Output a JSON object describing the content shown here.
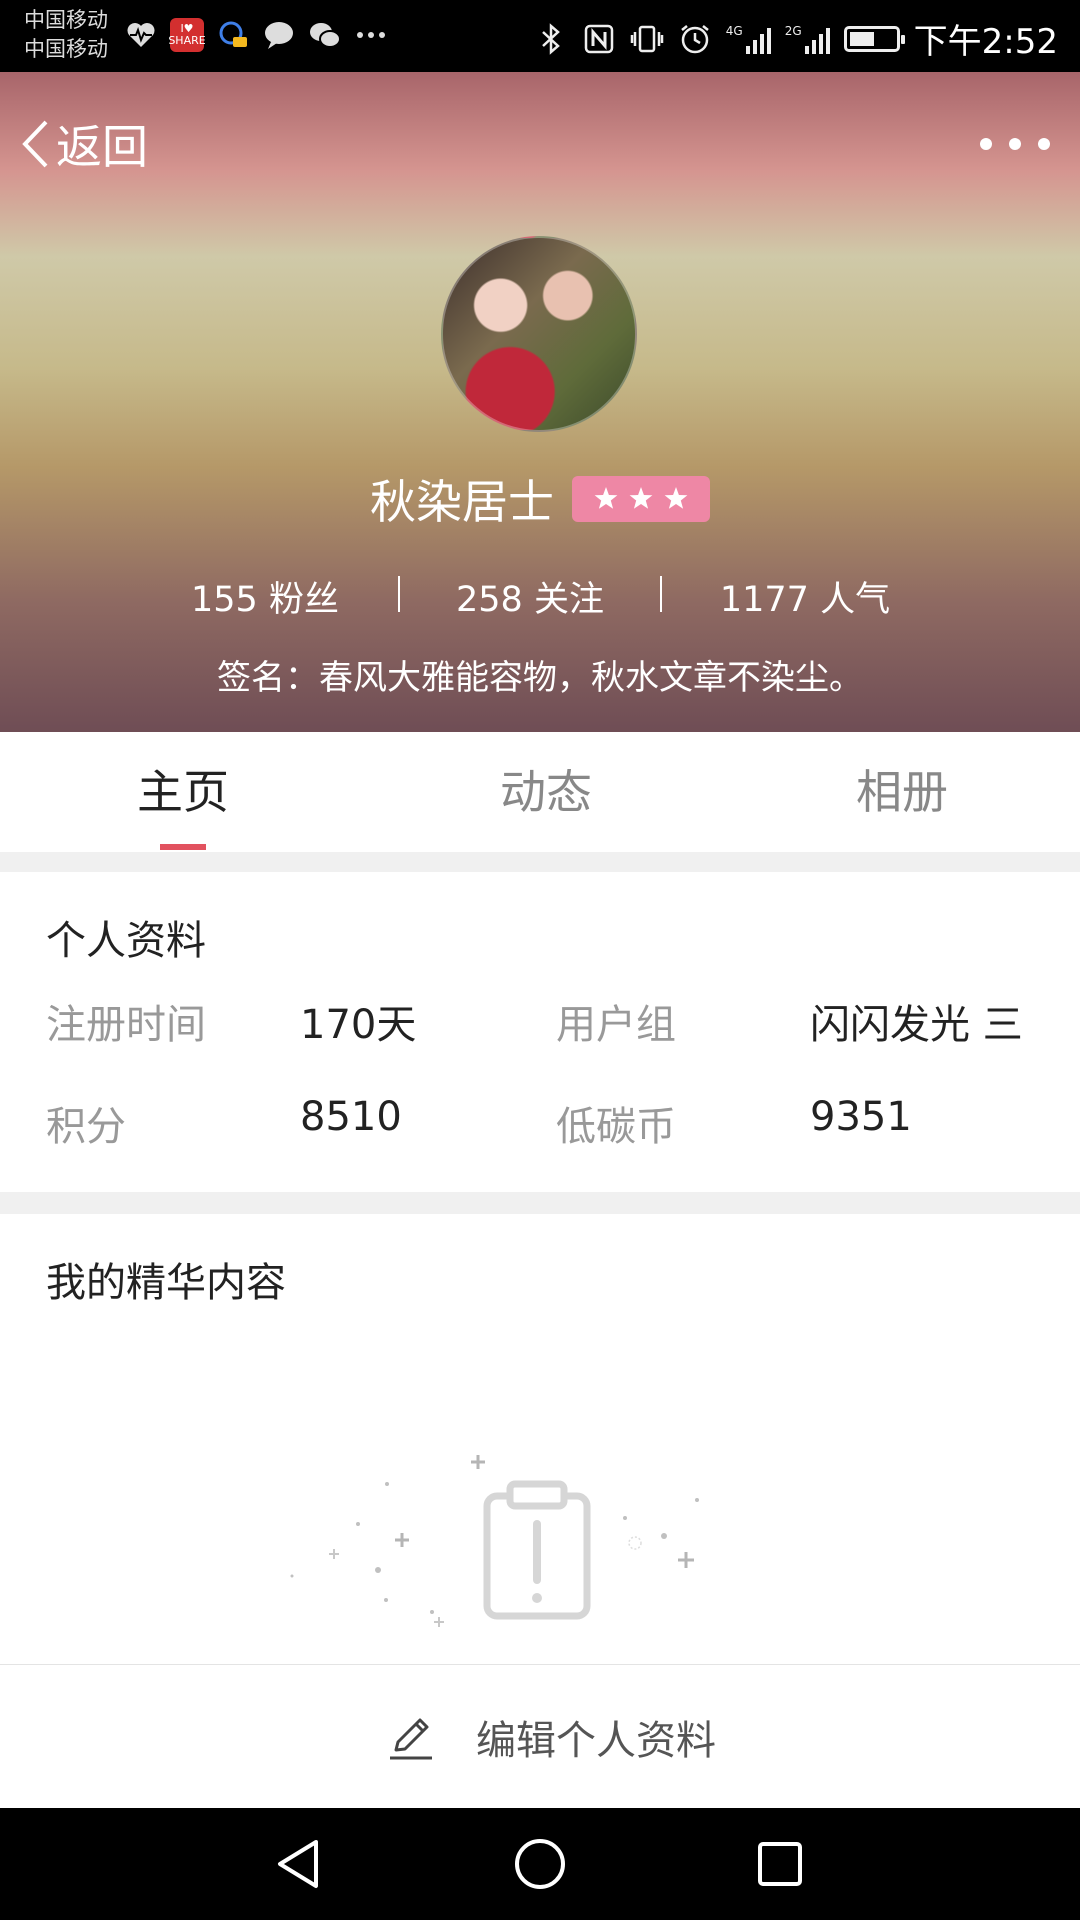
{
  "status_bar": {
    "carrier_1": "中国移动",
    "carrier_2": "中国移动",
    "share_badge": "I♥ SHARE",
    "time": "下午2:52",
    "network_1": "4G",
    "network_2": "2G",
    "icons_left": [
      "heartbeat-icon",
      "share-icon",
      "assistant-icon",
      "message-icon",
      "wechat-icon",
      "more-icon"
    ],
    "icons_right": [
      "bluetooth-icon",
      "nfc-icon",
      "vibrate-icon",
      "alarm-icon",
      "signal-icon",
      "signal-icon",
      "battery-icon"
    ],
    "battery_level": 0.55
  },
  "nav": {
    "back_label": "返回",
    "more_icon": "more-horizontal-icon"
  },
  "profile": {
    "username": "秋染居士",
    "level_stars": 3,
    "stats": [
      {
        "value": "155",
        "label": "粉丝"
      },
      {
        "value": "258",
        "label": "关注"
      },
      {
        "value": "1177",
        "label": "人气"
      }
    ],
    "signature": "签名：春风大雅能容物，秋水文章不染尘。"
  },
  "tabs": {
    "items": [
      {
        "label": "主页",
        "active": true
      },
      {
        "label": "动态",
        "active": false
      },
      {
        "label": "相册",
        "active": false
      }
    ],
    "accent": "#e2525f"
  },
  "personal_info": {
    "title": "个人资料",
    "rows": [
      {
        "label1": "注册时间",
        "value1": "170天",
        "label2": "用户组",
        "value2": "闪闪发光 三"
      },
      {
        "label1": "积分",
        "value1": "8510",
        "label2": "低碳币",
        "value2": "9351"
      }
    ]
  },
  "highlights": {
    "title": "我的精华内容",
    "empty_icon": "empty-clipboard-icon"
  },
  "edit": {
    "label": "编辑个人资料",
    "icon": "pencil-icon"
  },
  "system_nav": [
    "back-icon",
    "home-icon",
    "recents-icon"
  ]
}
